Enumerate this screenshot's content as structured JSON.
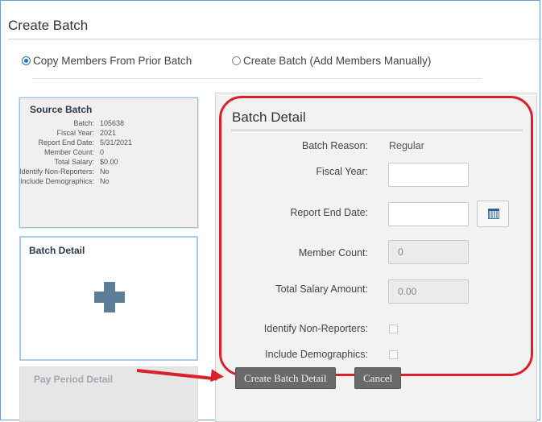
{
  "page": {
    "title": "Create Batch"
  },
  "options": {
    "copy_label": "Copy Members From Prior Batch",
    "create_label": "Create Batch (Add Members Manually)",
    "selected": "copy"
  },
  "source_batch": {
    "title": "Source Batch",
    "rows": [
      {
        "label": "Batch:",
        "value": "105638"
      },
      {
        "label": "Fiscal Year:",
        "value": "2021"
      },
      {
        "label": "Report End Date:",
        "value": "5/31/2021"
      },
      {
        "label": "Member Count:",
        "value": "0"
      },
      {
        "label": "Total Salary:",
        "value": "$0.00"
      },
      {
        "label": "Identify Non-Reporters:",
        "value": "No"
      },
      {
        "label": "Include Demographics:",
        "value": "No"
      }
    ]
  },
  "batch_detail_card": {
    "title": "Batch Detail",
    "icon": "plus-icon"
  },
  "pay_period_card": {
    "title": "Pay Period Detail"
  },
  "form": {
    "title": "Batch Detail",
    "batch_reason_label": "Batch Reason:",
    "batch_reason_value": "Regular",
    "fiscal_year_label": "Fiscal Year:",
    "fiscal_year_value": "",
    "report_end_date_label": "Report End Date:",
    "report_end_date_value": "",
    "member_count_label": "Member Count:",
    "member_count_value": "0",
    "total_salary_label": "Total Salary Amount:",
    "total_salary_value": "0.00",
    "identify_label": "Identify Non-Reporters:",
    "identify_checked": false,
    "demographics_label": "Include Demographics:",
    "demographics_checked": false
  },
  "buttons": {
    "create": "Create Batch Detail",
    "cancel": "Cancel"
  },
  "colors": {
    "accent": "#1e73be",
    "annotation": "#d8212b",
    "button": "#6a6a6a"
  }
}
